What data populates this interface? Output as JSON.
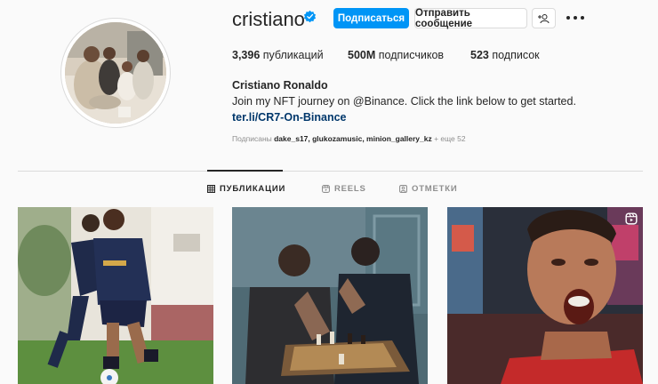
{
  "profile": {
    "username": "cristiano",
    "follow_label": "Подписаться",
    "message_label": "Отправить сообщение",
    "stats": {
      "posts": "3,396",
      "posts_label": " публикаций",
      "followers": "500M",
      "followers_label": " подписчиков",
      "following": "523",
      "following_label": " подписок"
    },
    "full_name": "Cristiano Ronaldo",
    "bio": "Join my NFT journey on @Binance. Click the link below to get started.",
    "link": "ter.li/CR7-On-Binance",
    "followed_by_prefix": "Подписаны ",
    "followed_by_names": "dake_s17, glukozamusic, minion_gallery_kz",
    "followed_by_suffix": " + еще 52"
  },
  "tabs": [
    {
      "label": "ПУБЛИКАЦИИ",
      "icon": "grid-icon",
      "active": true
    },
    {
      "label": "REELS",
      "icon": "reels-icon",
      "active": false
    },
    {
      "label": "ОТМЕТКИ",
      "icon": "tagged-icon",
      "active": false
    }
  ],
  "colors": {
    "accent": "#0095f6",
    "link": "#00376b",
    "text": "#262626",
    "muted": "#8e8e8e",
    "border": "#dbdbdb",
    "background": "#fafafa"
  },
  "posts": [
    {
      "description": "training-photo",
      "kind": "photo"
    },
    {
      "description": "chess-photo",
      "kind": "photo"
    },
    {
      "description": "celebration-photo",
      "kind": "reel",
      "badge_icon": "reel-icon"
    }
  ]
}
